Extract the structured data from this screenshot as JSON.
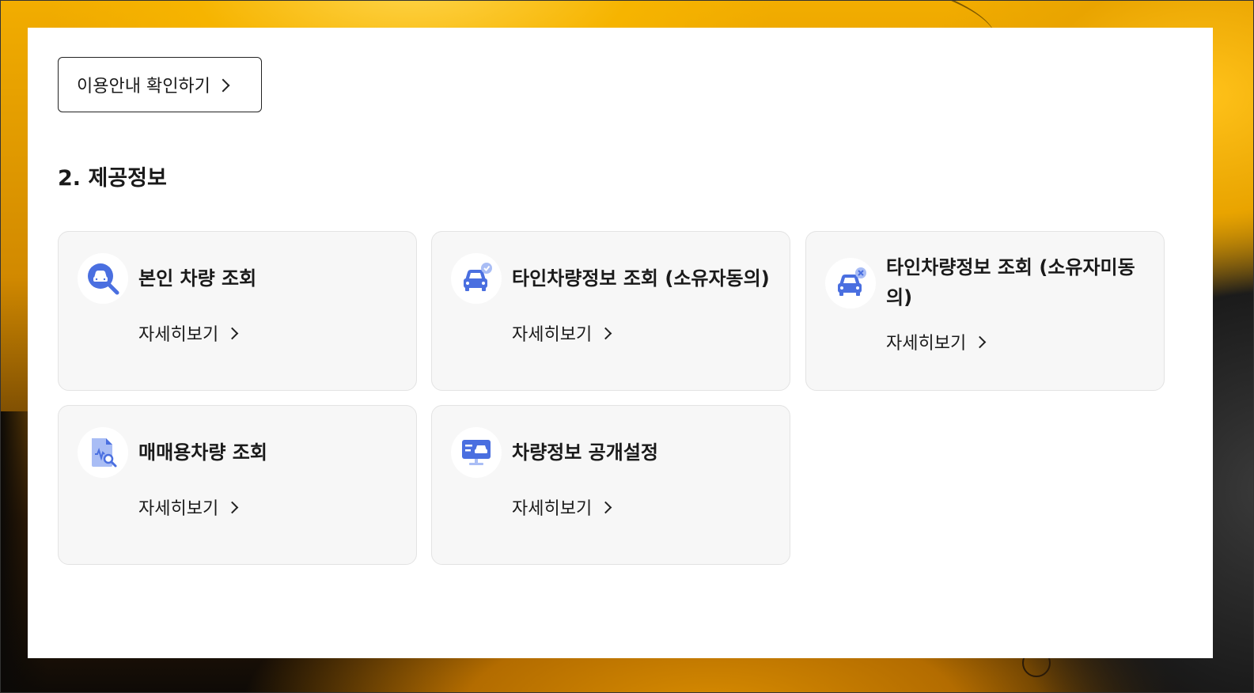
{
  "guide_button": {
    "label": "이용안내 확인하기"
  },
  "section": {
    "title": "2. 제공정보"
  },
  "cards": [
    {
      "title": "본인 차량 조회",
      "link": "자세히보기",
      "icon": "car-search-icon"
    },
    {
      "title": "타인차량정보 조회 (소유자동의)",
      "link": "자세히보기",
      "icon": "car-check-icon"
    },
    {
      "title": "타인차량정보 조회 (소유자미동의)",
      "link": "자세히보기",
      "icon": "car-x-icon"
    },
    {
      "title": "매매용차량 조회",
      "link": "자세히보기",
      "icon": "document-search-icon"
    },
    {
      "title": "차량정보 공개설정",
      "link": "자세히보기",
      "icon": "monitor-car-icon"
    }
  ],
  "colors": {
    "icon_blue": "#4a6fe0",
    "icon_light": "#a9bdf5",
    "card_bg": "#f7f7f7"
  }
}
